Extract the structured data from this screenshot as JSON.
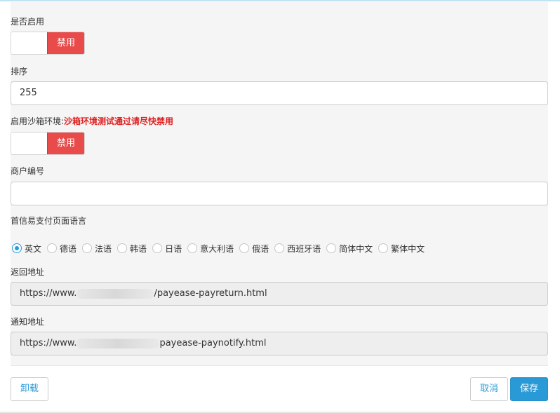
{
  "form": {
    "enable": {
      "label": "是否启用",
      "state_label": "禁用"
    },
    "sort": {
      "label": "排序",
      "value": "255"
    },
    "sandbox": {
      "label": "启用沙箱环境:",
      "warning": "沙箱环境测试通过请尽快禁用",
      "state_label": "禁用"
    },
    "merchant": {
      "label": "商户编号",
      "value": ""
    },
    "language": {
      "label": "首信易支付页面语言",
      "selected": "英文",
      "options": [
        "英文",
        "德语",
        "法语",
        "韩语",
        "日语",
        "意大利语",
        "俄语",
        "西班牙语",
        "简体中文",
        "繁体中文"
      ]
    },
    "return_url": {
      "label": "返回地址",
      "prefix": "https://www.",
      "suffix": "/payease-payreturn.html"
    },
    "notify_url": {
      "label": "通知地址",
      "prefix": "https://www.",
      "suffix": "payease-paynotify.html"
    }
  },
  "footer": {
    "uninstall": "卸载",
    "cancel": "取消",
    "save": "保存"
  },
  "colors": {
    "primary": "#2a9ad7",
    "danger": "#e94b4b"
  }
}
